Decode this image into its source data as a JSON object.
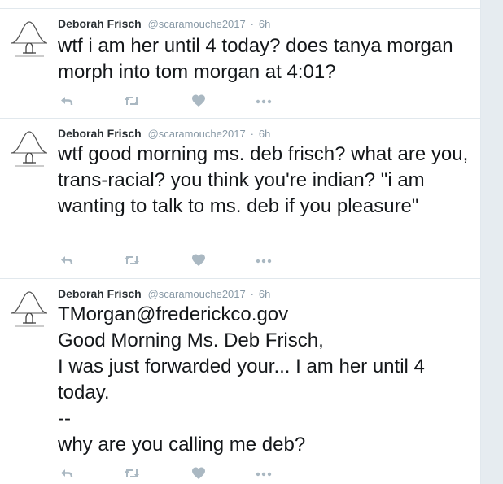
{
  "tweets": [
    {
      "fullname": "Deborah Frisch",
      "username": "@scaramouche2017",
      "separator": "·",
      "time": "6h",
      "text": "wtf i am her until 4 today?  does tanya morgan morph into tom morgan at 4:01?"
    },
    {
      "fullname": "Deborah Frisch",
      "username": "@scaramouche2017",
      "separator": "·",
      "time": "6h",
      "text": "wtf good morning ms. deb frisch?  what are you, trans-racial?  you think you're indian? \"i am wanting to talk to ms. deb if you pleasure\""
    },
    {
      "fullname": "Deborah Frisch",
      "username": "@scaramouche2017",
      "separator": "·",
      "time": "6h",
      "text": "TMorgan@frederickco.gov\nGood Morning Ms. Deb Frisch,\nI was just forwarded your...  I am her until 4 today.\n--\nwhy are you calling me deb?"
    }
  ],
  "icons": {
    "reply": "reply-icon",
    "retweet": "retweet-icon",
    "like": "heart-icon",
    "more": "more-icon",
    "avatar": "bell-curve-avatar"
  },
  "colors": {
    "action_icon": "#aab8c2",
    "name": "#292f33",
    "meta": "#8899a6",
    "text": "#14171a",
    "border": "#e1e8ed"
  }
}
